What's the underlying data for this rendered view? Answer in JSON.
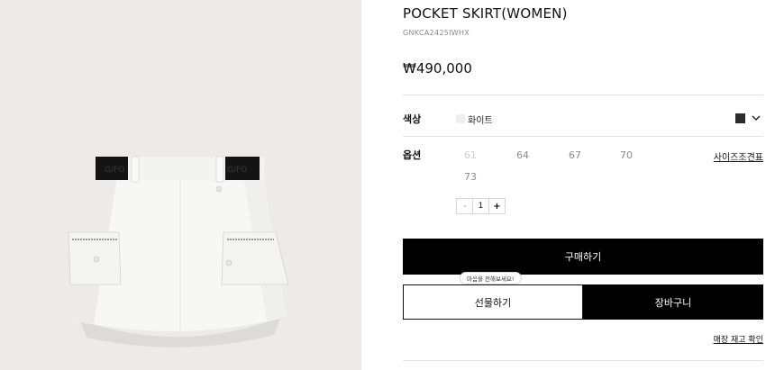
{
  "product": {
    "title": "POCKET SKIRT(WOMEN)",
    "sku": "GNKCA2425IWHX",
    "price": "₩490,000",
    "image_logo_text": "G/FO"
  },
  "color": {
    "label": "색상",
    "selected_name": "화이트",
    "chip_color": "#2b2b2b",
    "chevron_icon": "chevron-down-icon"
  },
  "option": {
    "label": "옵션",
    "sizes": [
      {
        "label": "61",
        "available": false
      },
      {
        "label": "64",
        "available": true
      },
      {
        "label": "67",
        "available": true
      },
      {
        "label": "70",
        "available": true
      },
      {
        "label": "73",
        "available": true
      }
    ],
    "size_guide": "사이즈조견표"
  },
  "quantity": {
    "minus": "-",
    "value": "1",
    "plus": "+"
  },
  "actions": {
    "buy": "구매하기",
    "gift_tooltip": "마음을 전해보세요!",
    "gift": "선물하기",
    "cart": "장바구니",
    "stock_check": "매장 재고 확인"
  }
}
